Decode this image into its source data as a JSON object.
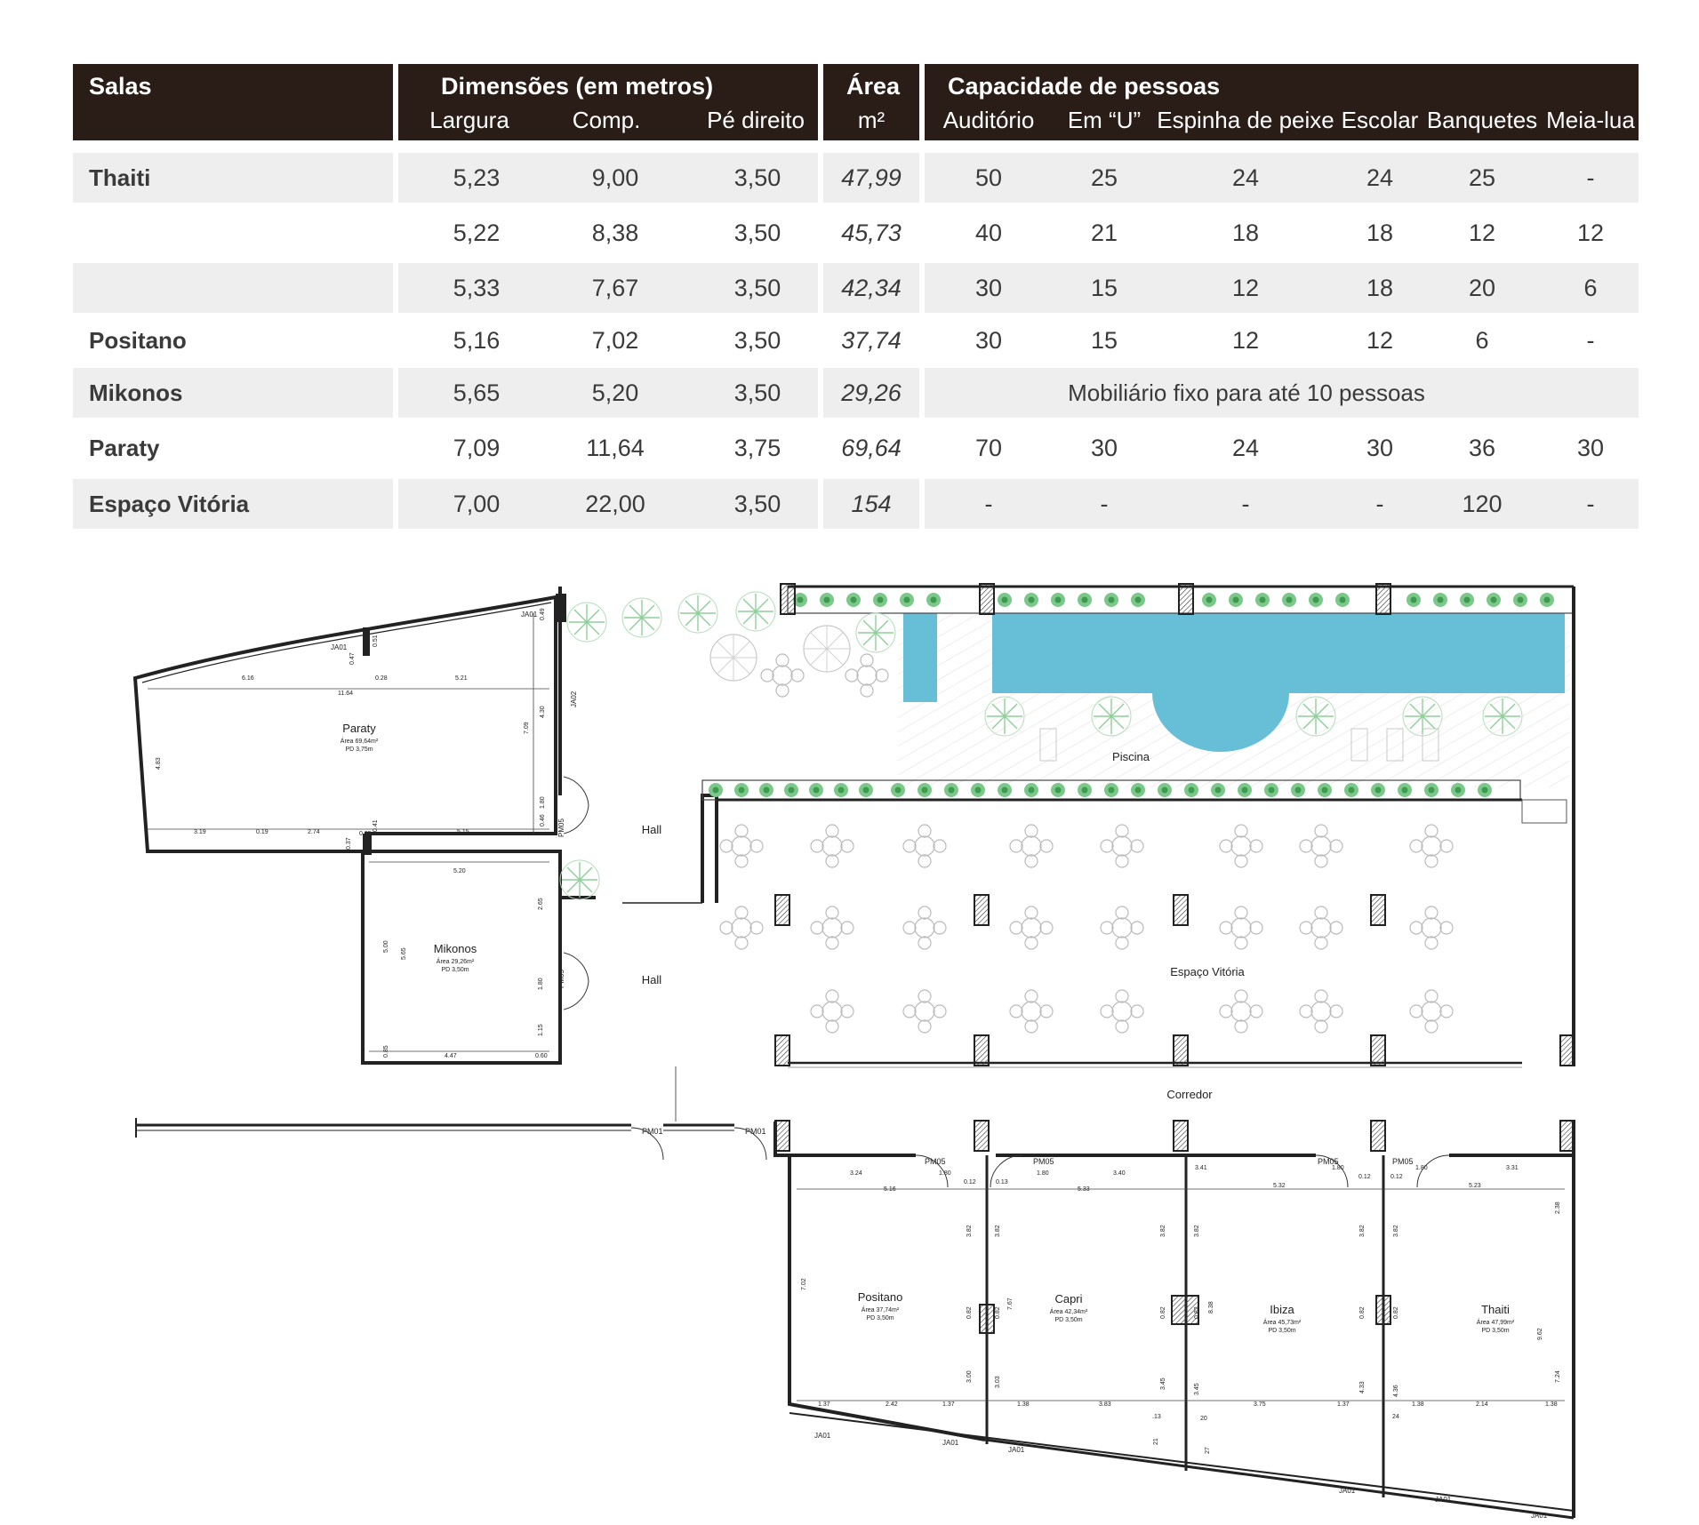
{
  "table": {
    "headers": {
      "salas": "Salas",
      "dimensoes": "Dimensões (em metros)",
      "largura": "Largura",
      "comp": "Comp.",
      "pe_direito": "Pé direito",
      "area": "Área",
      "area_unit": "m²",
      "capacidade": "Capacidade de pessoas",
      "auditorio": "Auditório",
      "em_u": "Em “U”",
      "espinha": "Espinha de peixe",
      "escolar": "Escolar",
      "banquetes": "Banquetes",
      "meia_lua": "Meia-lua"
    },
    "rows": [
      {
        "name": "Thaiti",
        "largura": "5,23",
        "comp": "9,00",
        "pe": "3,50",
        "area": "47,99",
        "cap": [
          "50",
          "25",
          "24",
          "24",
          "25",
          "-"
        ]
      },
      {
        "name": "",
        "largura": "5,22",
        "comp": "8,38",
        "pe": "3,50",
        "area": "45,73",
        "cap": [
          "40",
          "21",
          "18",
          "18",
          "12",
          "12"
        ]
      },
      {
        "name": "",
        "largura": "5,33",
        "comp": "7,67",
        "pe": "3,50",
        "area": "42,34",
        "cap": [
          "30",
          "15",
          "12",
          "18",
          "20",
          "6"
        ]
      },
      {
        "name": "Positano",
        "largura": "5,16",
        "comp": "7,02",
        "pe": "3,50",
        "area": "37,74",
        "cap": [
          "30",
          "15",
          "12",
          "12",
          "6",
          "-"
        ]
      },
      {
        "name": "Mikonos",
        "largura": "5,65",
        "comp": "5,20",
        "pe": "3,50",
        "area": "29,26",
        "note": "Mobiliário fixo para até 10 pessoas"
      },
      {
        "name": "Paraty",
        "largura": "7,09",
        "comp": "11,64",
        "pe": "3,75",
        "area": "69,64",
        "cap": [
          "70",
          "30",
          "24",
          "30",
          "36",
          "30"
        ]
      },
      {
        "name": "Espaço Vitória",
        "largura": "7,00",
        "comp": "22,00",
        "pe": "3,50",
        "area": "154",
        "cap": [
          "-",
          "-",
          "-",
          "-",
          "120",
          "-"
        ]
      }
    ]
  },
  "plan": {
    "rooms": {
      "paraty": {
        "name": "Paraty",
        "area": "Área 69,64m²",
        "pd": "PD 3,75m"
      },
      "mikonos": {
        "name": "Mikonos",
        "area": "Área 29,26m²",
        "pd": "PD 3,50m"
      },
      "positano": {
        "name": "Positano",
        "area": "Área 37,74m²",
        "pd": "PD 3,50m"
      },
      "capri": {
        "name": "Capri",
        "area": "Área 42,34m²",
        "pd": "PD 3,50m"
      },
      "ibiza": {
        "name": "Ibiza",
        "area": "Área 45,73m²",
        "pd": "PD 3,50m"
      },
      "thaiti": {
        "name": "Thaiti",
        "area": "Área 47,99m²",
        "pd": "PD 3,50m"
      }
    },
    "spaces": {
      "hall": "Hall",
      "piscina": "Piscina",
      "espaco_vitoria": "Espaço Vitória",
      "corredor": "Corredor"
    },
    "tags": {
      "ja01": "JA01",
      "ja02": "JA02",
      "pm01": "PM01",
      "pm05": "PM05"
    },
    "dims": {
      "d616": "6.16",
      "d028": "0.28",
      "d521": "5.21",
      "d1164": "11.64",
      "d047": "0.47",
      "d051": "0.51",
      "d049": "0.49",
      "d483": "4.83",
      "d709": "7.09",
      "d430": "4.30",
      "d180": "1.80",
      "d046": "0.46",
      "d319": "3.19",
      "d019": "0.19",
      "d274": "2.74",
      "d037": "0.37",
      "d025": "0.25",
      "d041": "0.41",
      "d515": "5.15",
      "d520": "5.20",
      "d265": "2.65",
      "d500": "5.00",
      "d565": "5.65",
      "d115": "1.15",
      "d085": "0.85",
      "d447": "4.47",
      "d060": "0.60",
      "d324": "3.24",
      "d012": "0.12",
      "d516": "5.16",
      "d382": "3.82",
      "d082": "0.82",
      "d702": "7.02",
      "d300": "3.00",
      "d137": "1.37",
      "d242": "2.42",
      "d013": "0.13",
      "d340": "3.40",
      "d533": "5.33",
      "d767": "7.67",
      "d303": "3.03",
      "d138": "1.38",
      "d383": "3.83",
      "d345": "3.45",
      "d13": ".13",
      "d21": "21",
      "d341": "3.41",
      "d532": "5.32",
      "d838": "8.38",
      "d375": "3.75",
      "d433": "4.33",
      "d20": "20",
      "d27": "27",
      "d331": "3.31",
      "d523": "5.23",
      "d238": "2.38",
      "d962": "9.62",
      "d436": "4.36",
      "d724": "7.24",
      "d214": "2.14",
      "d24": "24"
    }
  }
}
